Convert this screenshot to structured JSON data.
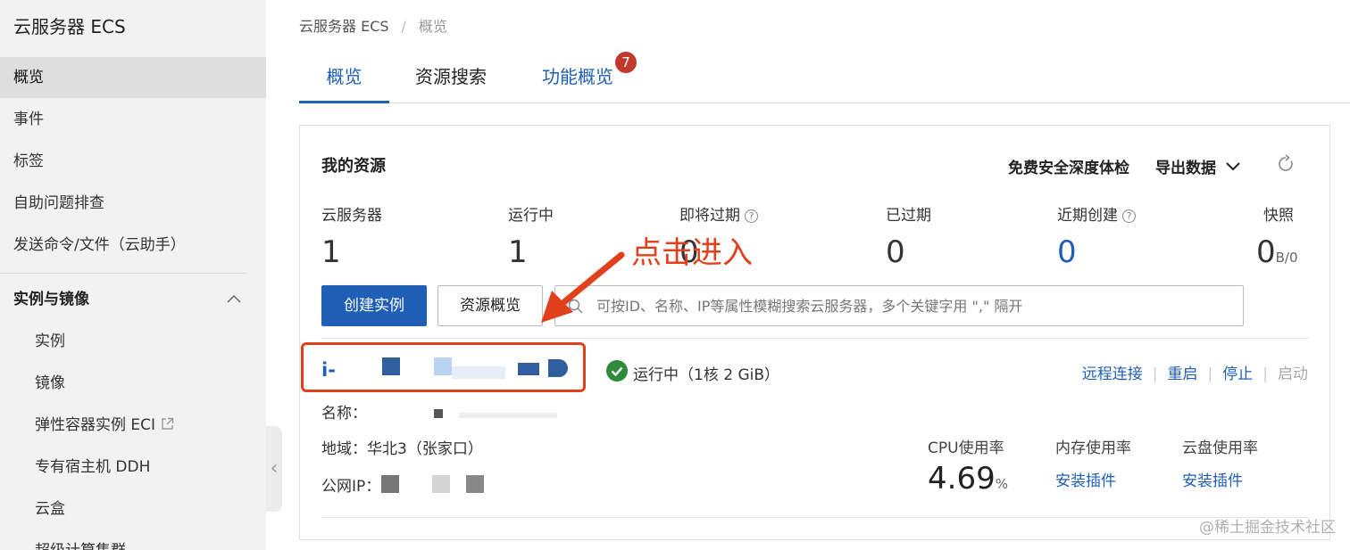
{
  "sidebar": {
    "title": "云服务器 ECS",
    "items": [
      {
        "label": "概览",
        "active": true
      },
      {
        "label": "事件"
      },
      {
        "label": "标签"
      },
      {
        "label": "自助问题排查"
      },
      {
        "label": "发送命令/文件（云助手）"
      }
    ],
    "section": {
      "label": "实例与镜像",
      "expanded": true
    },
    "sub_items": [
      {
        "label": "实例"
      },
      {
        "label": "镜像"
      },
      {
        "label": "弹性容器实例 ECI",
        "external": true
      },
      {
        "label": "专有宿主机 DDH"
      },
      {
        "label": "云盒"
      },
      {
        "label": "超级计算集群"
      }
    ]
  },
  "breadcrumb": {
    "root": "云服务器 ECS",
    "separator": "/",
    "current": "概览"
  },
  "tabs": [
    {
      "label": "概览",
      "active": true
    },
    {
      "label": "资源搜索"
    },
    {
      "label": "功能概览",
      "badge": "7"
    }
  ],
  "resources": {
    "title": "我的资源",
    "security_check": "免费安全深度体检",
    "export_label": "导出数据",
    "stats": [
      {
        "label": "云服务器",
        "value": "1"
      },
      {
        "label": "运行中",
        "value": "1"
      },
      {
        "label": "即将过期",
        "value": "0",
        "help": true
      },
      {
        "label": "已过期",
        "value": "0"
      },
      {
        "label": "近期创建",
        "value": "0",
        "help": true,
        "accent": "#1f5fb5"
      },
      {
        "label": "快照",
        "value": "0",
        "unit": "B/0"
      }
    ],
    "create_button": "创建实例",
    "overview_button": "资源概览",
    "search_placeholder": "可按ID、名称、IP等属性模糊搜索云服务器，多个关键字用 \",\" 隔开"
  },
  "instance": {
    "id_prefix": "i-",
    "status": "运行中（1核 2 GiB）",
    "status_color": "#2e8b3e",
    "actions": [
      "远程连接",
      "重启",
      "停止",
      "启动"
    ],
    "name_label": "名称：",
    "region_label": "地域：",
    "region_value": "华北3（张家口）",
    "ip_label": "公网IP：",
    "metrics": [
      {
        "label": "CPU使用率",
        "value": "4.69",
        "unit": "%"
      },
      {
        "label": "内存使用率",
        "link": "安装插件"
      },
      {
        "label": "云盘使用率",
        "link": "安装插件"
      }
    ]
  },
  "annotation": {
    "text": "点击进入",
    "color": "#e0401c"
  },
  "watermark": "@稀土掘金技术社区",
  "colors": {
    "accent": "#1f5fb5",
    "sidebar_bg": "#f2f2f2",
    "badge": "#c0392b"
  }
}
